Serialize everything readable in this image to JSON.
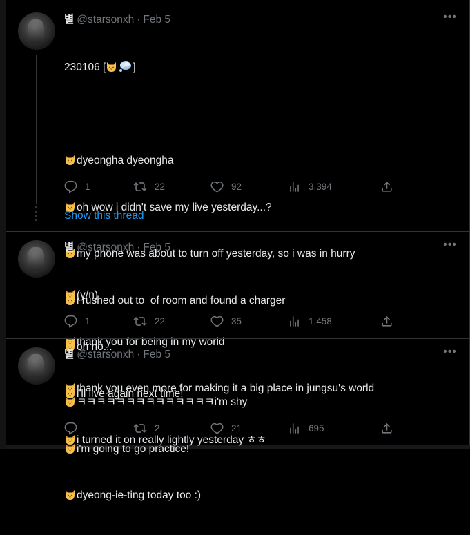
{
  "theme": {
    "background": "#000000",
    "text": "#e7e9ea",
    "muted": "#71767b",
    "link": "#1d9bf0",
    "divider": "#2f3336"
  },
  "emoji": {
    "cat": "cat-face-emoji",
    "thought": "thought-balloon-emoji"
  },
  "tweets": [
    {
      "author": {
        "name": "별",
        "handle": "@starsonxh"
      },
      "date": "Feb 5",
      "separator": "·",
      "lines": [
        {
          "prefix": "230106 [",
          "suffix": "]"
        },
        {
          "text": ""
        },
        {
          "text": "dyeongha dyeongha"
        },
        {
          "text": "oh wow i didn't save my live yesterday...?"
        },
        {
          "text": "my phone was about to turn off yesterday, so i was in hurry"
        },
        {
          "text": "i rushed out to  of room and found a charger"
        },
        {
          "text": "oh no..."
        },
        {
          "text": "i'll live again next time!"
        },
        {
          "text": "i turned it on really lightly yesterday ㅎㅎ"
        }
      ],
      "stats": {
        "replies": "1",
        "retweets": "22",
        "likes": "92",
        "views": "3,394"
      }
    },
    {
      "author": {
        "name": "별",
        "handle": "@starsonxh"
      },
      "date": "Feb 5",
      "separator": "·",
      "lines": [
        {
          "text": "(y/n)"
        },
        {
          "text": "thank you for being in my world"
        },
        {
          "text": "thank you even more for making it a big place in jungsu's world"
        }
      ],
      "stats": {
        "replies": "1",
        "retweets": "22",
        "likes": "35",
        "views": "1,458"
      }
    },
    {
      "author": {
        "name": "별",
        "handle": "@starsonxh"
      },
      "date": "Feb 5",
      "separator": "·",
      "lines": [
        {
          "text": "ㅋㅋㅋㅋㅋㅋㅋㅋㅋㅋㅋㅋㅋㅋi'm shy"
        },
        {
          "text": "i'm going to go practice!"
        },
        {
          "text": "dyeong-ie-ting today too :)"
        }
      ],
      "stats": {
        "replies": "",
        "retweets": "2",
        "likes": "21",
        "views": "695"
      }
    }
  ],
  "show_thread": "Show this thread"
}
